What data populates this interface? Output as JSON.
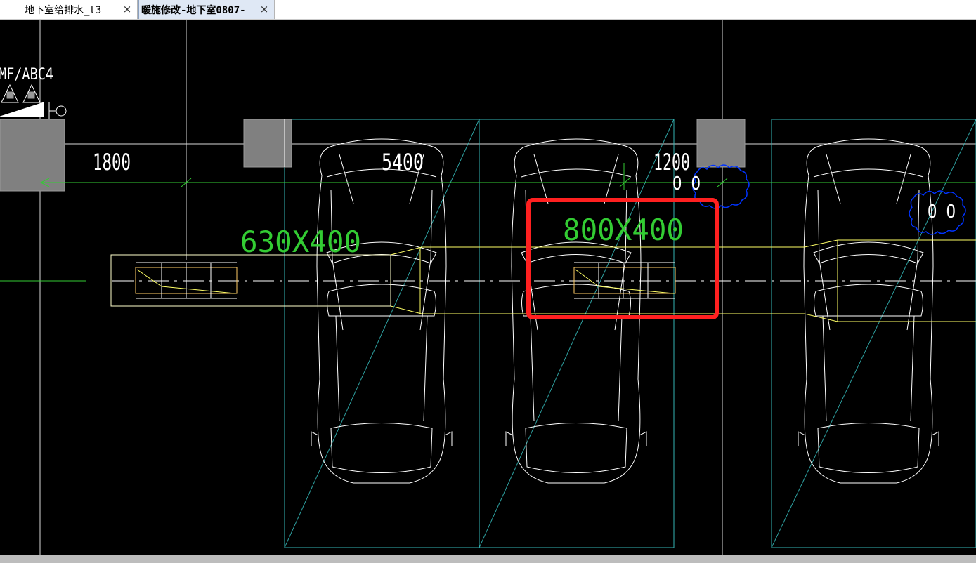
{
  "tabs": [
    {
      "label": "地下室给排水_t3",
      "close": "×",
      "active": false
    },
    {
      "label": "暖施修改-地下室0807-",
      "close": "×",
      "active": true
    }
  ],
  "drawing": {
    "equipment_tag": "MF/ABC4",
    "dimensions": {
      "d1": "1800",
      "d2": "5400",
      "d3": "1200"
    },
    "duct_sizes": {
      "duct_left": "630X400",
      "duct_highlighted": "800X400"
    },
    "revision_cloud_labels": {
      "cloud_1": "O O",
      "cloud_2": "O O"
    },
    "highlighted_item": "800X400"
  },
  "colors": {
    "background": "#000000",
    "grid_line": "#ffffff",
    "duct": "#ffff66",
    "duct_outline": "#ffffcc",
    "dimension_text": "#ffffff",
    "duct_label": "#33cc33",
    "green_line": "#33cc33",
    "parking_bay": "#33b3b3",
    "column": "#808080",
    "revision_cloud": "#0033ff",
    "highlight_box": "#ff2020"
  }
}
